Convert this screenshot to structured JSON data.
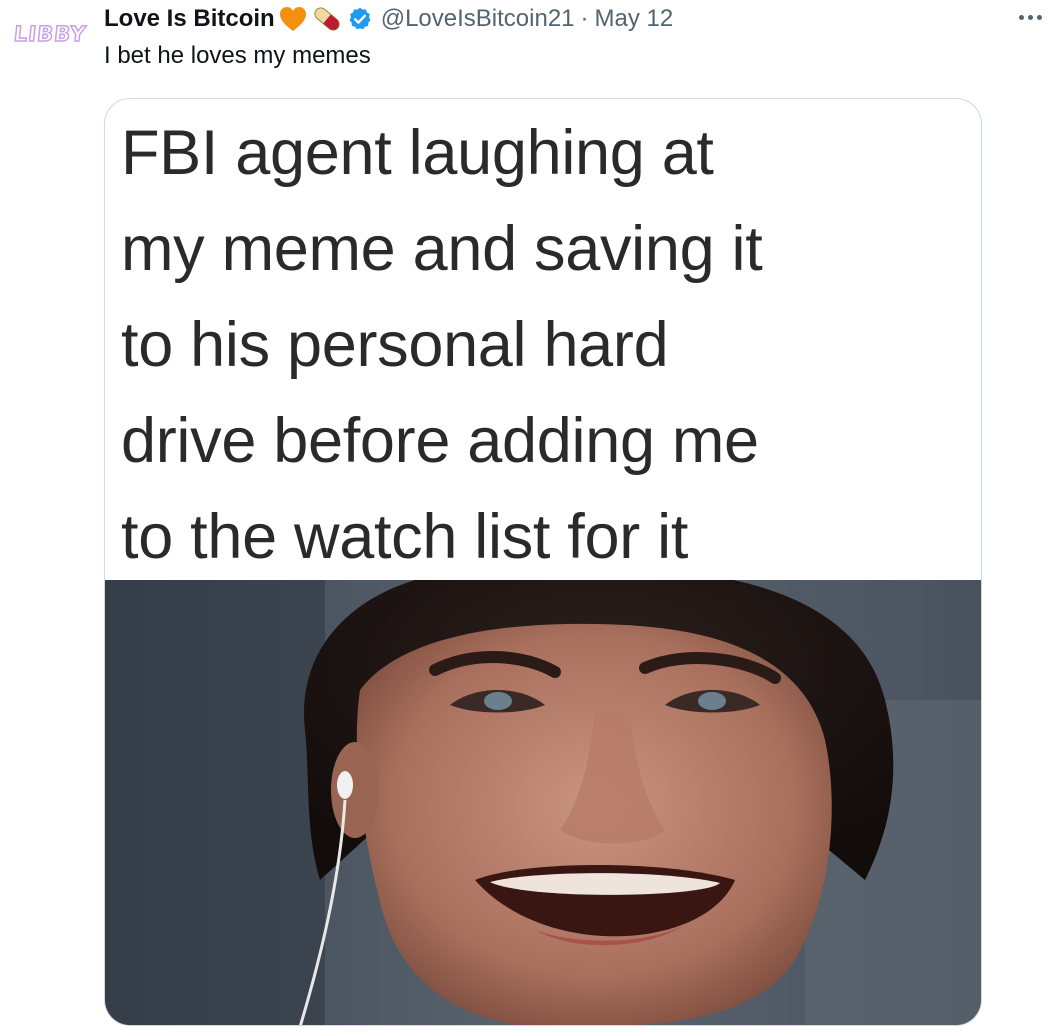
{
  "tweet": {
    "avatar_text": "LIBBY",
    "display_name": "Love Is Bitcoin",
    "name_emojis": [
      "orange-heart",
      "pill"
    ],
    "verified": true,
    "handle": "@LoveIsBitcoin21",
    "separator": "·",
    "date": "May 12",
    "text": "I bet he loves my memes",
    "media": {
      "caption_lines": [
        "FBI agent laughing at",
        "my meme and saving it",
        "to his personal hard",
        "drive before adding me",
        "to the watch list for it"
      ]
    }
  },
  "colors": {
    "primary_text": "#0f1419",
    "secondary_text": "#536471",
    "verified_blue": "#1d9bf0",
    "border": "#cfd9de",
    "avatar_purple": "#c9a0e6"
  }
}
